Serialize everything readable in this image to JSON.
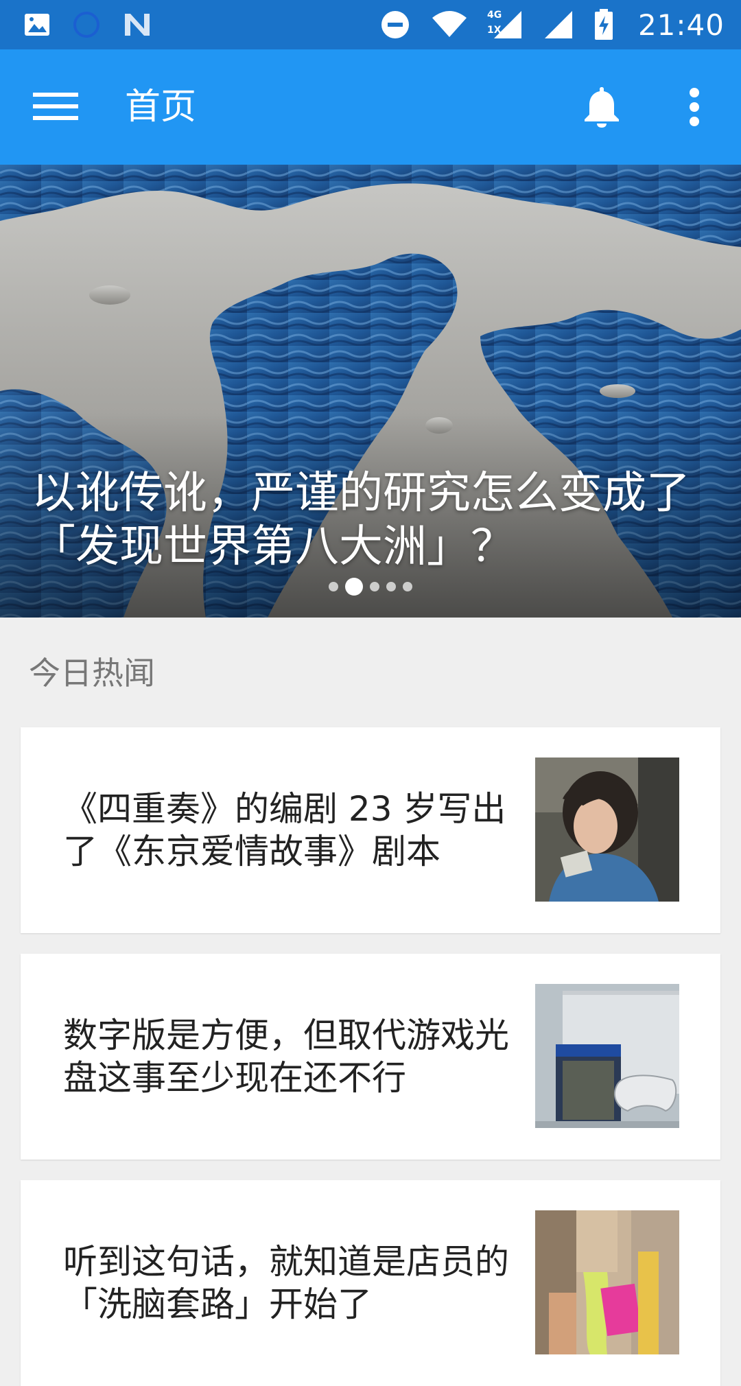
{
  "status_bar": {
    "time": "21:40",
    "network_top": "4G",
    "network_bottom": "1X"
  },
  "app_bar": {
    "title": "首页"
  },
  "hero": {
    "title": "以讹传讹，严谨的研究怎么变成了「发现世界第八大洲」？",
    "carousel_index": 2,
    "carousel_count": 5
  },
  "section": {
    "title": "今日热闻"
  },
  "stories": [
    {
      "title": "《四重奏》的编剧 23 岁写出了《东京爱情故事》剧本"
    },
    {
      "title": "数字版是方便，但取代游戏光盘这事至少现在还不行"
    },
    {
      "title": "听到这句话，就知道是店员的「洗脑套路」开始了"
    }
  ],
  "colors": {
    "status_bar": "#1a73c9",
    "app_bar": "#2196f3",
    "background": "#efefef"
  }
}
